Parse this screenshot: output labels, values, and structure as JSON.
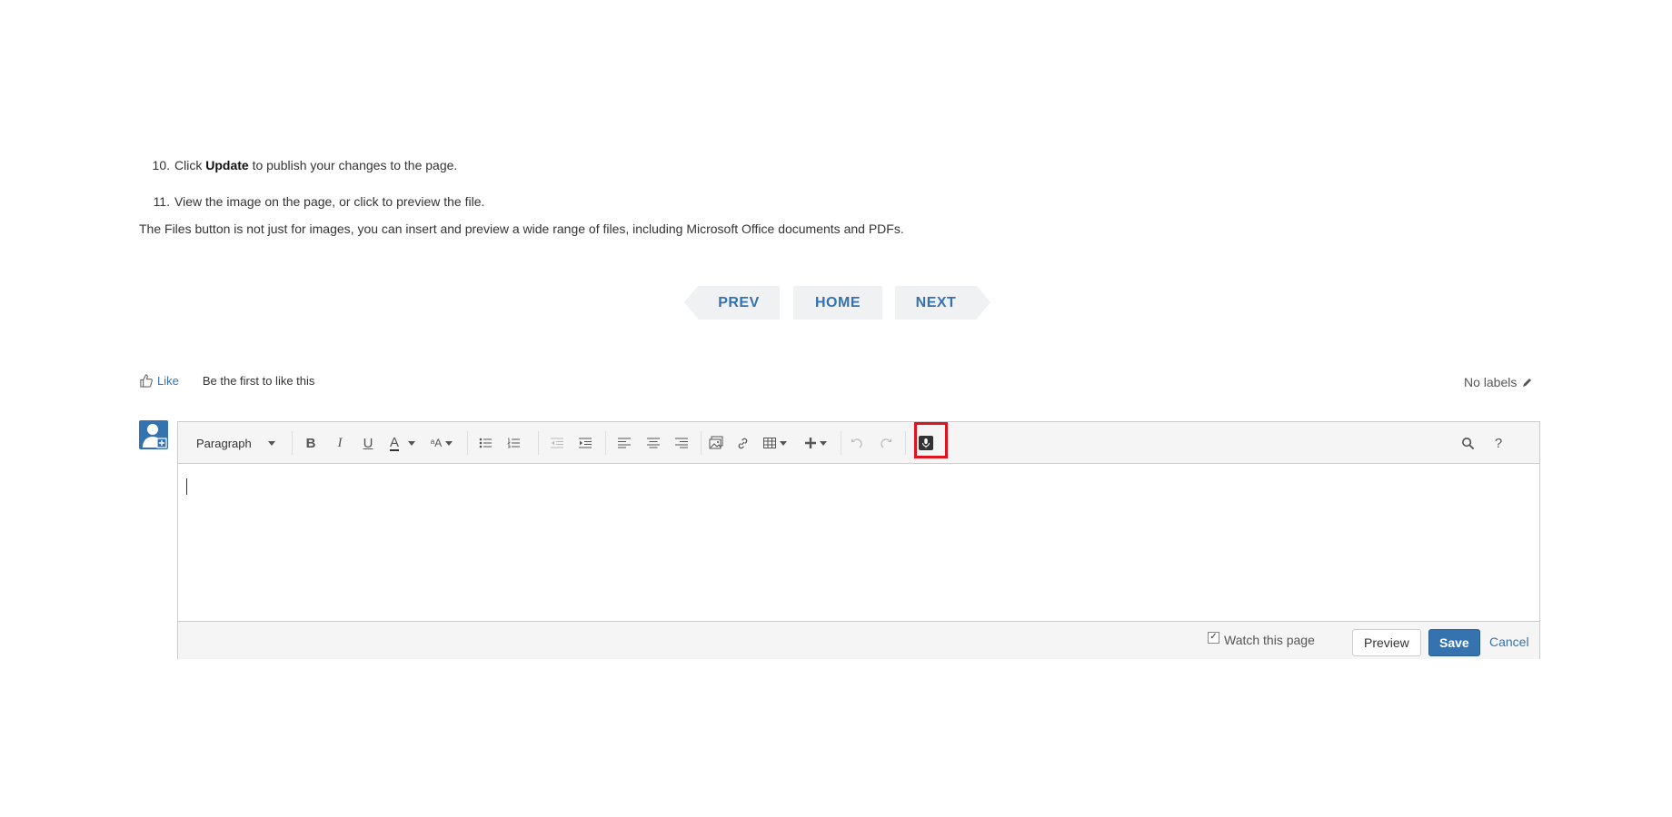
{
  "steps": [
    {
      "num": "10.",
      "pre": "Click ",
      "bold": "Update",
      "post": " to publish your changes to the page."
    },
    {
      "num": "11.",
      "text": "View the image on the page, or click to preview the file."
    }
  ],
  "files_note": "The Files button is not just for images, you can insert and preview a wide range of files, including Microsoft Office documents and PDFs.",
  "nav": {
    "prev": "PREV",
    "home": "HOME",
    "next": "NEXT"
  },
  "like": {
    "label": "Like",
    "text": "Be the first to like this"
  },
  "labels": {
    "text": "No labels"
  },
  "toolbar": {
    "paragraph": "Paragraph",
    "bold": "B",
    "italic": "I",
    "underline": "U",
    "text_color": "A",
    "formatting": "ᵃA",
    "search": "⚲",
    "help": "?"
  },
  "footer": {
    "watch": "Watch this page",
    "watch_checked": true,
    "preview": "Preview",
    "save": "Save",
    "cancel": "Cancel"
  },
  "colors": {
    "accent": "#3572b0",
    "highlight": "#e0141e"
  }
}
